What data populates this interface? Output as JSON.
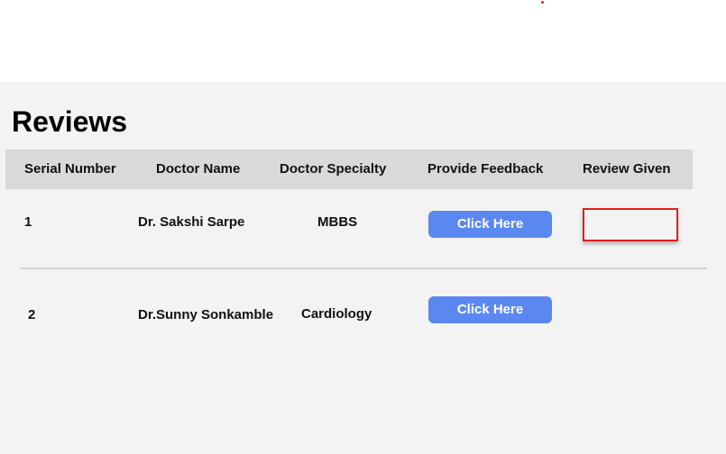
{
  "page": {
    "title": "Reviews"
  },
  "table": {
    "headers": [
      "Serial Number",
      "Doctor Name",
      "Doctor Specialty",
      "Provide Feedback",
      "Review Given"
    ],
    "rows": [
      {
        "serial": "1",
        "doctor": "Dr. Sakshi Sarpe",
        "specialty": "MBBS",
        "feedback_button": "Click Here",
        "review_given": ""
      },
      {
        "serial": "2",
        "doctor": "Dr.Sunny Sonkamble",
        "specialty": "Cardiology",
        "feedback_button": "Click Here",
        "review_given": ""
      }
    ]
  },
  "colors": {
    "button": "#5b87f0",
    "header_bg": "#d9d9d9",
    "panel_bg": "#f3f3f3",
    "highlight_border": "#e02020"
  }
}
